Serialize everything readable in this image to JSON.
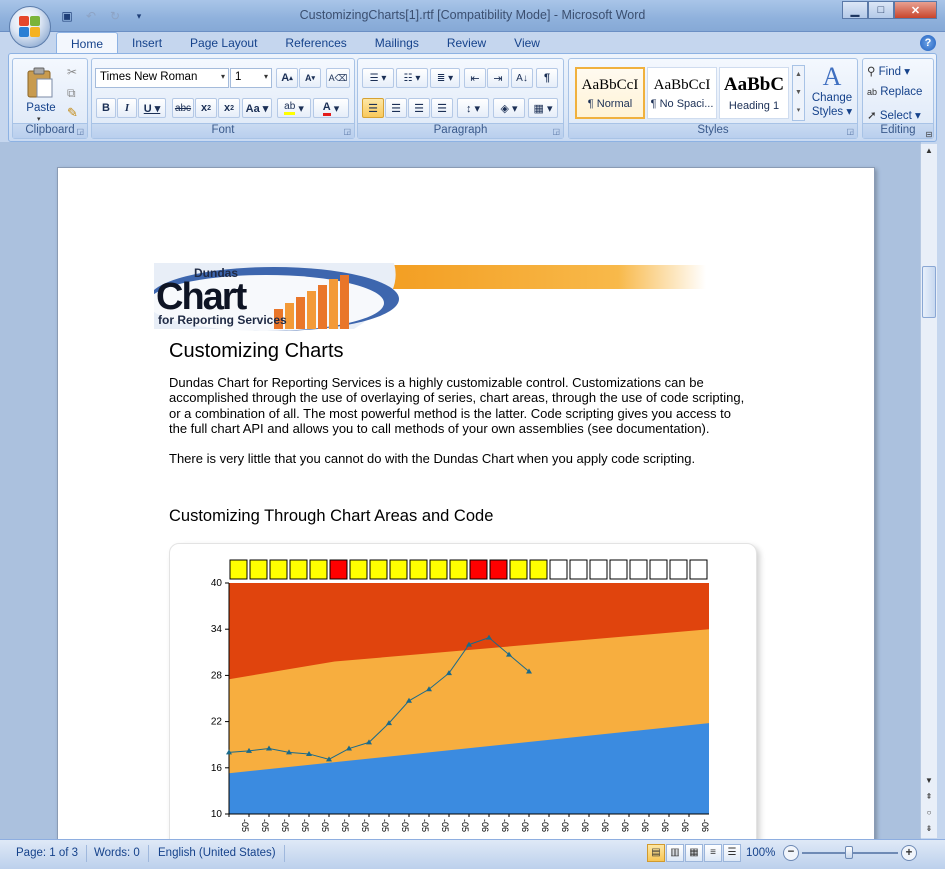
{
  "window": {
    "title": "CustomizingCharts[1].rtf [Compatibility Mode] - Microsoft Word"
  },
  "ribbon_tabs": [
    "Home",
    "Insert",
    "Page Layout",
    "References",
    "Mailings",
    "Review",
    "View"
  ],
  "clipboard": {
    "paste_label": "Paste",
    "group_label": "Clipboard"
  },
  "font": {
    "font_name": "Times New Roman",
    "font_size": "1",
    "group_label": "Font"
  },
  "paragraph": {
    "group_label": "Paragraph"
  },
  "styles": {
    "group_label": "Styles",
    "items": [
      {
        "sample": "AaBbCcI",
        "name": "¶ Normal"
      },
      {
        "sample": "AaBbCcI",
        "name": "¶ No Spaci..."
      },
      {
        "sample": "AaBbC",
        "name": "Heading 1"
      }
    ],
    "change_styles_line1": "Change",
    "change_styles_line2": "Styles"
  },
  "editing": {
    "group_label": "Editing",
    "find": "Find",
    "replace": "Replace",
    "select": "Select"
  },
  "document": {
    "banner": {
      "line1": "Dundas",
      "line2": "Chart",
      "line3": "for Reporting Services"
    },
    "heading": "Customizing Charts",
    "para1_lines": [
      "Dundas Chart  for Reporting Services is a highly customizable control.  Customizations can  be",
      "accomplished through the use  of overlaying of series, chart areas, through the use of code scripting,",
      "or a combination of all.  The most powerful method is the latter.  Code scripting gives you access to",
      "the full chart API and allows you to call methods of your own assemblies (see  documentation)."
    ],
    "para2": "There  is very little that you cannot do with the Dundas Chart  when  you apply code scripting.",
    "subheading": "Customizing  Through  Chart Areas  and  Code"
  },
  "chart_data": {
    "type": "area",
    "ylim": [
      10,
      40
    ],
    "yticks": [
      10,
      16,
      22,
      28,
      34,
      40
    ],
    "x_tick_labels": [
      "-05",
      "-05",
      "-05",
      "-05",
      "-05",
      "-05",
      "-05",
      "-05",
      "-05",
      "-05",
      "-05",
      "-05",
      "-06",
      "-06",
      "-06",
      "-06",
      "-06",
      "-06",
      "-06",
      "-06",
      "-06",
      "-06",
      "-06",
      "-06"
    ],
    "area_bands": [
      {
        "color": "#3b8be0",
        "start": 15.3,
        "end": 21.8
      },
      {
        "color": "#f7ae3f",
        "start": 27.5,
        "end": 34.0
      },
      {
        "color": "#e0440d",
        "start": 40,
        "end": 40
      }
    ],
    "line": {
      "color": "#1a6a8a",
      "values": [
        18.0,
        18.2,
        18.5,
        18.0,
        17.8,
        17.1,
        18.5,
        19.3,
        21.8,
        24.7,
        26.2,
        28.3,
        32.0,
        32.9,
        30.7,
        28.5
      ]
    },
    "indicators": [
      "yellow",
      "yellow",
      "yellow",
      "yellow",
      "yellow",
      "red",
      "yellow",
      "yellow",
      "yellow",
      "yellow",
      "yellow",
      "yellow",
      "red",
      "red",
      "yellow",
      "yellow",
      "white",
      "white",
      "white",
      "white",
      "white",
      "white",
      "white",
      "white"
    ],
    "indicator_colors": {
      "yellow": "#ffff00",
      "red": "#ff0000",
      "white": "#ffffff"
    }
  },
  "status": {
    "page": "Page: 1 of 3",
    "words": "Words: 0",
    "language": "English (United States)",
    "zoom": "100%",
    "zoom_level": 1.0
  }
}
